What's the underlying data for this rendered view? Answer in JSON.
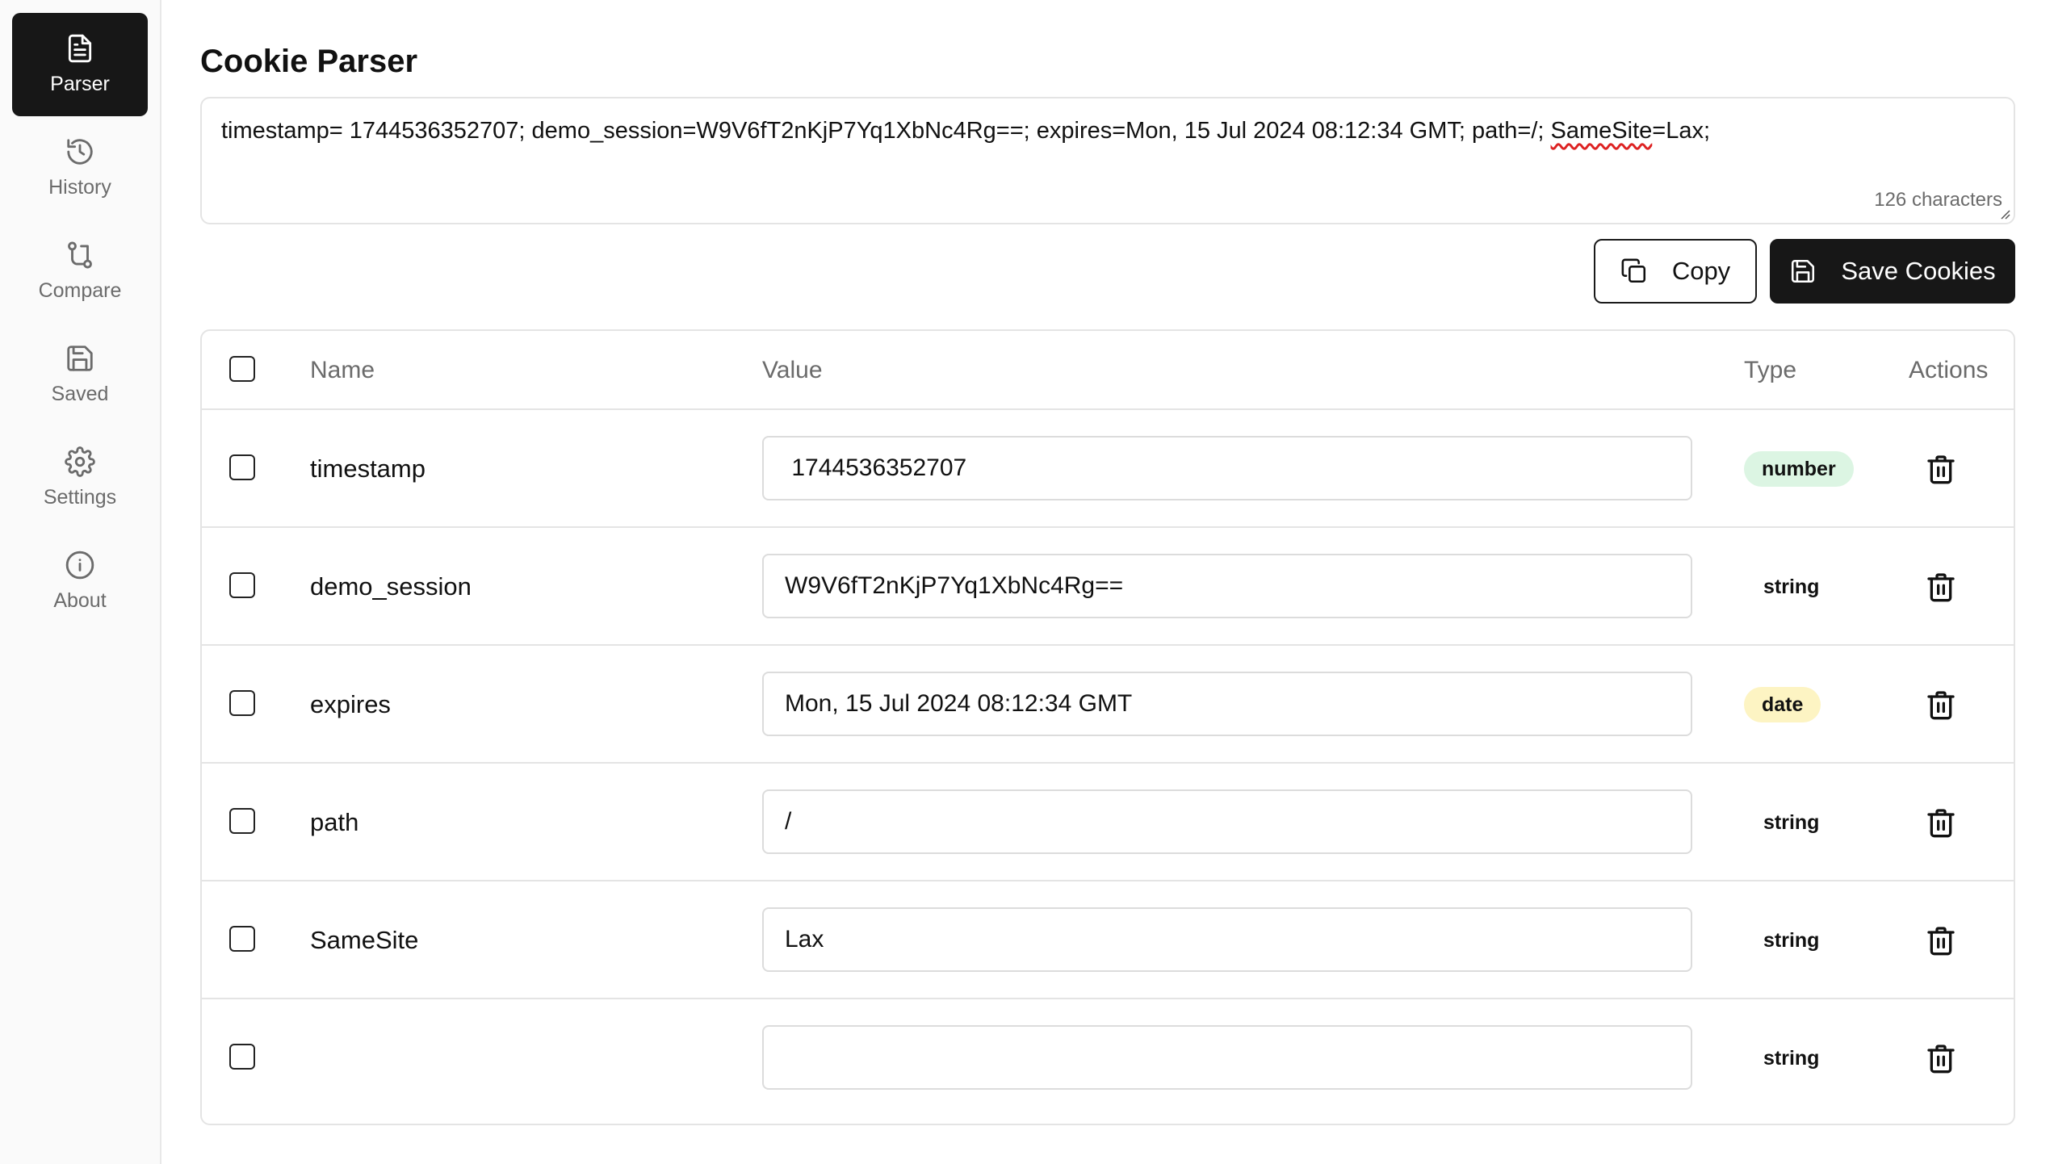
{
  "sidebar": {
    "items": [
      {
        "label": "Parser",
        "icon": "document-icon",
        "active": true
      },
      {
        "label": "History",
        "icon": "history-icon",
        "active": false
      },
      {
        "label": "Compare",
        "icon": "compare-icon",
        "active": false
      },
      {
        "label": "Saved",
        "icon": "save-icon",
        "active": false
      },
      {
        "label": "Settings",
        "icon": "gear-icon",
        "active": false
      },
      {
        "label": "About",
        "icon": "info-icon",
        "active": false
      }
    ]
  },
  "header": {
    "title": "Cookie Parser"
  },
  "cookie_input": {
    "value_before": "timestamp= 1744536352707; demo_session=W9V6fT2nKjP7Yq1XbNc4Rg==; expires=Mon, 15 Jul 2024 08:12:34 GMT; path=/; ",
    "value_flagged": "SameSite",
    "value_after": "=Lax;",
    "char_count": "126 characters"
  },
  "toolbar": {
    "copy_label": "Copy",
    "save_label": "Save Cookies"
  },
  "table": {
    "headers": {
      "name": "Name",
      "value": "Value",
      "type": "Type",
      "actions": "Actions"
    },
    "rows": [
      {
        "name": "timestamp",
        "value": " 1744536352707",
        "type": "number"
      },
      {
        "name": "demo_session",
        "value": "W9V6fT2nKjP7Yq1XbNc4Rg==",
        "type": "string"
      },
      {
        "name": "expires",
        "value": "Mon, 15 Jul 2024 08:12:34 GMT",
        "type": "date"
      },
      {
        "name": "path",
        "value": "/",
        "type": "string"
      },
      {
        "name": "SameSite",
        "value": "Lax",
        "type": "string"
      },
      {
        "name": "",
        "value": "",
        "type": "string"
      }
    ]
  },
  "colors": {
    "primary": "#171717",
    "badge_number": "#dcf5e3",
    "badge_date": "#fdf4c3",
    "border": "#e4e4e4",
    "muted_text": "#6b6b6b"
  }
}
